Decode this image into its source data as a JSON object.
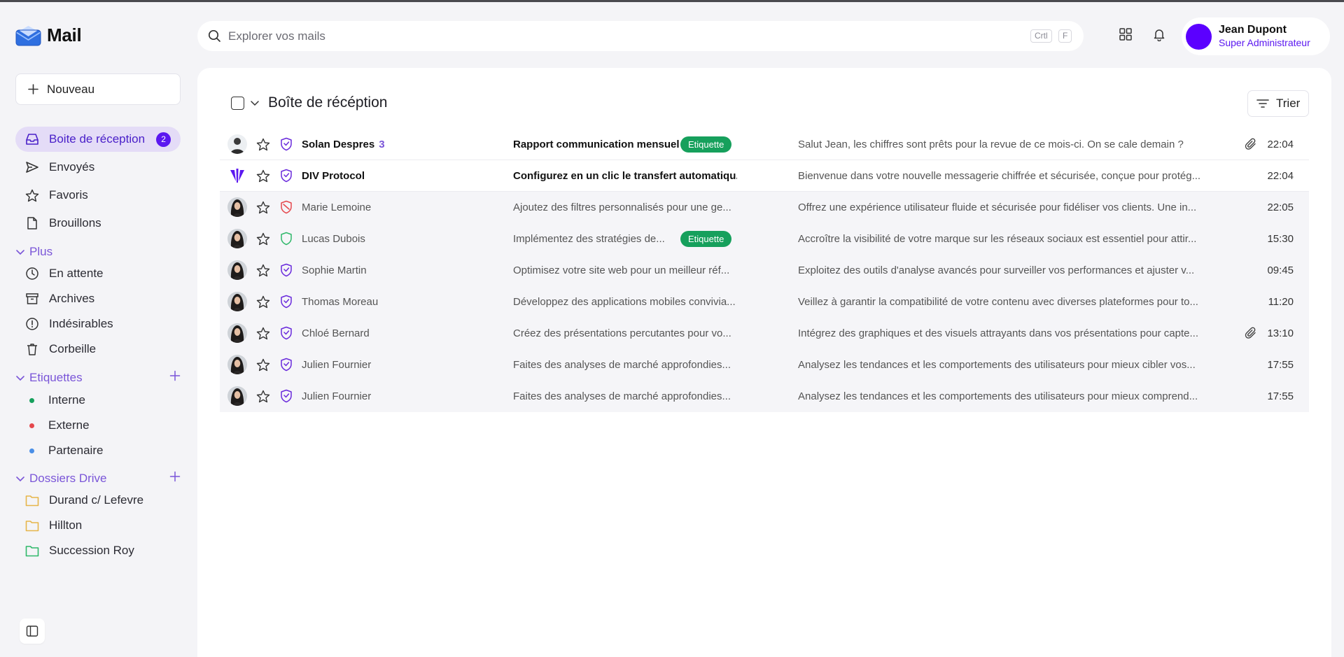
{
  "app": {
    "title": "Mail"
  },
  "sidebar": {
    "new_label": "Nouveau",
    "primary": [
      {
        "label": "Boite de réception",
        "icon": "inbox-icon",
        "badge": "2",
        "active": true
      },
      {
        "label": "Envoyés",
        "icon": "send-icon"
      },
      {
        "label": "Favoris",
        "icon": "star-icon"
      },
      {
        "label": "Brouillons",
        "icon": "draft-icon"
      }
    ],
    "more_label": "Plus",
    "more": [
      {
        "label": "En attente",
        "icon": "clock-icon"
      },
      {
        "label": "Archives",
        "icon": "archive-icon"
      },
      {
        "label": "Indésirables",
        "icon": "spam-icon"
      },
      {
        "label": "Corbeille",
        "icon": "trash-icon"
      }
    ],
    "labels_title": "Etiquettes",
    "labels": [
      {
        "label": "Interne",
        "color": "#16a05c"
      },
      {
        "label": "Externe",
        "color": "#e5484d"
      },
      {
        "label": "Partenaire",
        "color": "#4a8fe7"
      }
    ],
    "drive_title": "Dossiers Drive",
    "drive": [
      {
        "label": "Durand c/ Lefevre",
        "color": "#e6b54a"
      },
      {
        "label": "Hillton",
        "color": "#e6b54a"
      },
      {
        "label": "Succession Roy",
        "color": "#2fb86a"
      }
    ]
  },
  "topbar": {
    "search_placeholder": "Explorer vos mails",
    "shortcut_key1": "Crtl",
    "shortcut_key2": "F",
    "user_name": "Jean Dupont",
    "user_role": "Super Administrateur"
  },
  "main": {
    "title": "Boîte de récéption",
    "sort_label": "Trier"
  },
  "colors": {
    "accent": "#5b18f0",
    "tag": "#16a05c",
    "shield_default": "#6a2bdc",
    "shield_red": "#e5484d",
    "shield_green": "#2fb86a"
  },
  "emails": [
    {
      "from": "Solan Despres",
      "count": "3",
      "subject": "Rapport communication mensuel",
      "tag": "Etiquette",
      "preview": "Salut Jean, les chiffres sont prêts pour la revue de ce mois-ci. On se cale demain ?",
      "time": "22:04",
      "unread": true,
      "attachment": true,
      "avatar": "man",
      "shield": "default"
    },
    {
      "from": "DIV Protocol",
      "count": "",
      "subject": "Configurez en un clic le transfert automatiqu...",
      "tag": "",
      "preview": "Bienvenue dans votre nouvelle messagerie chiffrée et sécurisée, conçue pour protég...",
      "time": "22:04",
      "unread": true,
      "attachment": false,
      "avatar": "logo",
      "shield": "default"
    },
    {
      "from": "Marie Lemoine",
      "count": "",
      "subject": "Ajoutez des filtres personnalisés pour une ge...",
      "tag": "",
      "preview": "Offrez une expérience utilisateur fluide et sécurisée pour fidéliser vos clients. Une in...",
      "time": "22:05",
      "unread": false,
      "attachment": false,
      "avatar": "woman",
      "shield": "red"
    },
    {
      "from": "Lucas Dubois",
      "count": "",
      "subject": "Implémentez des stratégies de...",
      "tag": "Etiquette",
      "preview": "Accroître la visibilité de votre marque sur les réseaux sociaux est essentiel pour attir...",
      "time": "15:30",
      "unread": false,
      "attachment": false,
      "avatar": "woman",
      "shield": "green"
    },
    {
      "from": "Sophie Martin",
      "count": "",
      "subject": "Optimisez votre site web pour un meilleur réf...",
      "tag": "",
      "preview": "Exploitez des outils d'analyse avancés pour surveiller vos performances et ajuster v...",
      "time": "09:45",
      "unread": false,
      "attachment": false,
      "avatar": "woman",
      "shield": "default"
    },
    {
      "from": "Thomas Moreau",
      "count": "",
      "subject": "Développez des applications mobiles convivia...",
      "tag": "",
      "preview": "Veillez à garantir la compatibilité de votre contenu avec diverses plateformes pour to...",
      "time": "11:20",
      "unread": false,
      "attachment": false,
      "avatar": "woman",
      "shield": "default"
    },
    {
      "from": "Chloé Bernard",
      "count": "",
      "subject": "Créez des présentations percutantes pour vo...",
      "tag": "",
      "preview": "Intégrez des graphiques et des visuels attrayants dans vos présentations pour capte...",
      "time": "13:10",
      "unread": false,
      "attachment": true,
      "avatar": "woman",
      "shield": "default"
    },
    {
      "from": "Julien Fournier",
      "count": "",
      "subject": "Faites des analyses de marché approfondies...",
      "tag": "",
      "preview": "Analysez les tendances et les comportements des utilisateurs pour mieux cibler vos...",
      "time": "17:55",
      "unread": false,
      "attachment": false,
      "avatar": "woman",
      "shield": "default"
    },
    {
      "from": "Julien Fournier",
      "count": "",
      "subject": "Faites des analyses de marché approfondies...",
      "tag": "",
      "preview": "Analysez les tendances et les comportements des utilisateurs pour mieux comprend...",
      "time": "17:55",
      "unread": false,
      "attachment": false,
      "avatar": "woman",
      "shield": "default"
    }
  ]
}
